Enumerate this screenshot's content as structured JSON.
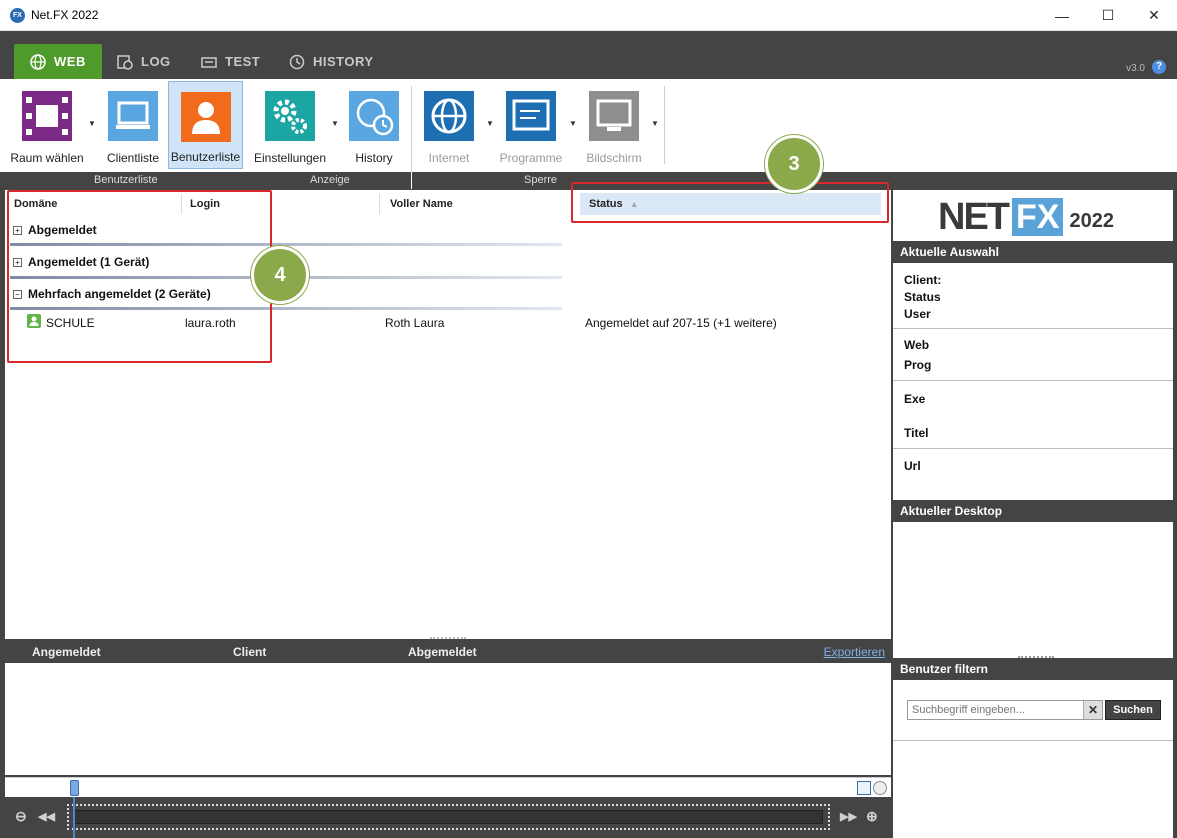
{
  "window": {
    "title": "Net.FX 2022",
    "minimize": "—",
    "maximize": "☐",
    "close": "✕"
  },
  "tabs": [
    {
      "label": "WEB",
      "active": true
    },
    {
      "label": "LOG"
    },
    {
      "label": "TEST"
    },
    {
      "label": "HISTORY"
    }
  ],
  "version": "v3.0",
  "help": "?",
  "ribbon": {
    "buttons": [
      {
        "label": "Raum wählen"
      },
      {
        "label": "Clientliste"
      },
      {
        "label": "Benutzerliste"
      },
      {
        "label": "Einstellungen"
      },
      {
        "label": "History"
      },
      {
        "label": "Internet"
      },
      {
        "label": "Programme"
      },
      {
        "label": "Bildschirm"
      }
    ],
    "groups": [
      "Benutzerliste",
      "Anzeige",
      "Sperre"
    ]
  },
  "grid": {
    "columns": [
      "Domäne",
      "Login",
      "Voller Name",
      "Status"
    ],
    "groups": [
      {
        "label": "Abgemeldet",
        "expander": "+"
      },
      {
        "label": "Angemeldet (1 Gerät)",
        "expander": "+"
      },
      {
        "label": "Mehrfach angemeldet (2 Geräte)",
        "expander": "−"
      }
    ],
    "rows": [
      {
        "domain": "SCHULE",
        "login": "laura.roth",
        "full_name": "Roth Laura",
        "status": "Angemeldet auf 207-15 (+1 weitere)"
      }
    ]
  },
  "callouts": [
    "3",
    "4"
  ],
  "log_panel": {
    "columns": [
      "Angemeldet",
      "Client",
      "Abgemeldet"
    ],
    "export_label": "Exportieren"
  },
  "right_panel": {
    "logo": {
      "net": "NET",
      "fx": "FX",
      "year": "2022"
    },
    "current_selection": {
      "title": "Aktuelle Auswahl",
      "labels": [
        "Client:",
        "Status",
        "User",
        "Web",
        "Prog",
        "Exe",
        "Titel",
        "Url"
      ]
    },
    "current_desktop_title": "Aktueller Desktop",
    "filter": {
      "title": "Benutzer filtern",
      "placeholder": "Suchbegriff eingeben...",
      "clear": "✕",
      "search_label": "Suchen"
    }
  },
  "timeline": {
    "zoom_out": "⊖",
    "rewind": "◀◀",
    "forward": "▶▶",
    "zoom_in": "⊕"
  },
  "colors": {
    "accent_green": "#4e9a2a",
    "dark": "#444444",
    "callout_red": "#d9282b",
    "badge_green": "#8ba84a"
  }
}
